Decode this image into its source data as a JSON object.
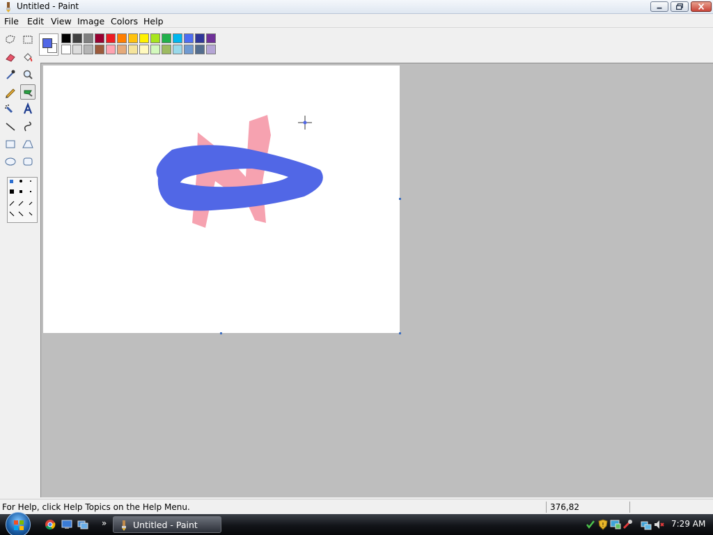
{
  "window": {
    "title": "Untitled - Paint"
  },
  "menu": [
    "File",
    "Edit",
    "View",
    "Image",
    "Colors",
    "Help"
  ],
  "tools": [
    {
      "name": "free-form-select-tool-icon"
    },
    {
      "name": "select-tool-icon"
    },
    {
      "name": "eraser-tool-icon"
    },
    {
      "name": "fill-tool-icon"
    },
    {
      "name": "pick-color-tool-icon"
    },
    {
      "name": "magnifier-tool-icon"
    },
    {
      "name": "pencil-tool-icon"
    },
    {
      "name": "brush-tool-icon",
      "active": true
    },
    {
      "name": "airbrush-tool-icon"
    },
    {
      "name": "text-tool-icon"
    },
    {
      "name": "line-tool-icon"
    },
    {
      "name": "curve-tool-icon"
    },
    {
      "name": "rectangle-tool-icon"
    },
    {
      "name": "polygon-tool-icon"
    },
    {
      "name": "ellipse-tool-icon"
    },
    {
      "name": "rounded-rectangle-tool-icon"
    }
  ],
  "colors": {
    "foreground": "#5167e6",
    "background": "#ffffff",
    "palette_top": [
      "#000000",
      "#404040",
      "#808080",
      "#990030",
      "#ed1c24",
      "#ff7e00",
      "#ffc20e",
      "#fff200",
      "#a8e61d",
      "#22b14c",
      "#00b7ef",
      "#4d6df3",
      "#2f3699",
      "#6f3198"
    ],
    "palette_bottom": [
      "#ffffff",
      "#dcdcdc",
      "#b4b4b4",
      "#9c5a3c",
      "#ffa3b1",
      "#e5aa7a",
      "#f5e49c",
      "#fff9bd",
      "#d3f9bc",
      "#9dbb61",
      "#99d9ea",
      "#709ad1",
      "#546d8e",
      "#b5a5d5"
    ]
  },
  "drawing": {
    "stroke_blue": "#5167e6",
    "stroke_pink": "#f6a2b0"
  },
  "status": {
    "help_text": "For Help, click Help Topics on the Help Menu.",
    "coordinates": "376,82"
  },
  "taskbar": {
    "task_label": "Untitled - Paint",
    "clock": "7:29 AM"
  }
}
